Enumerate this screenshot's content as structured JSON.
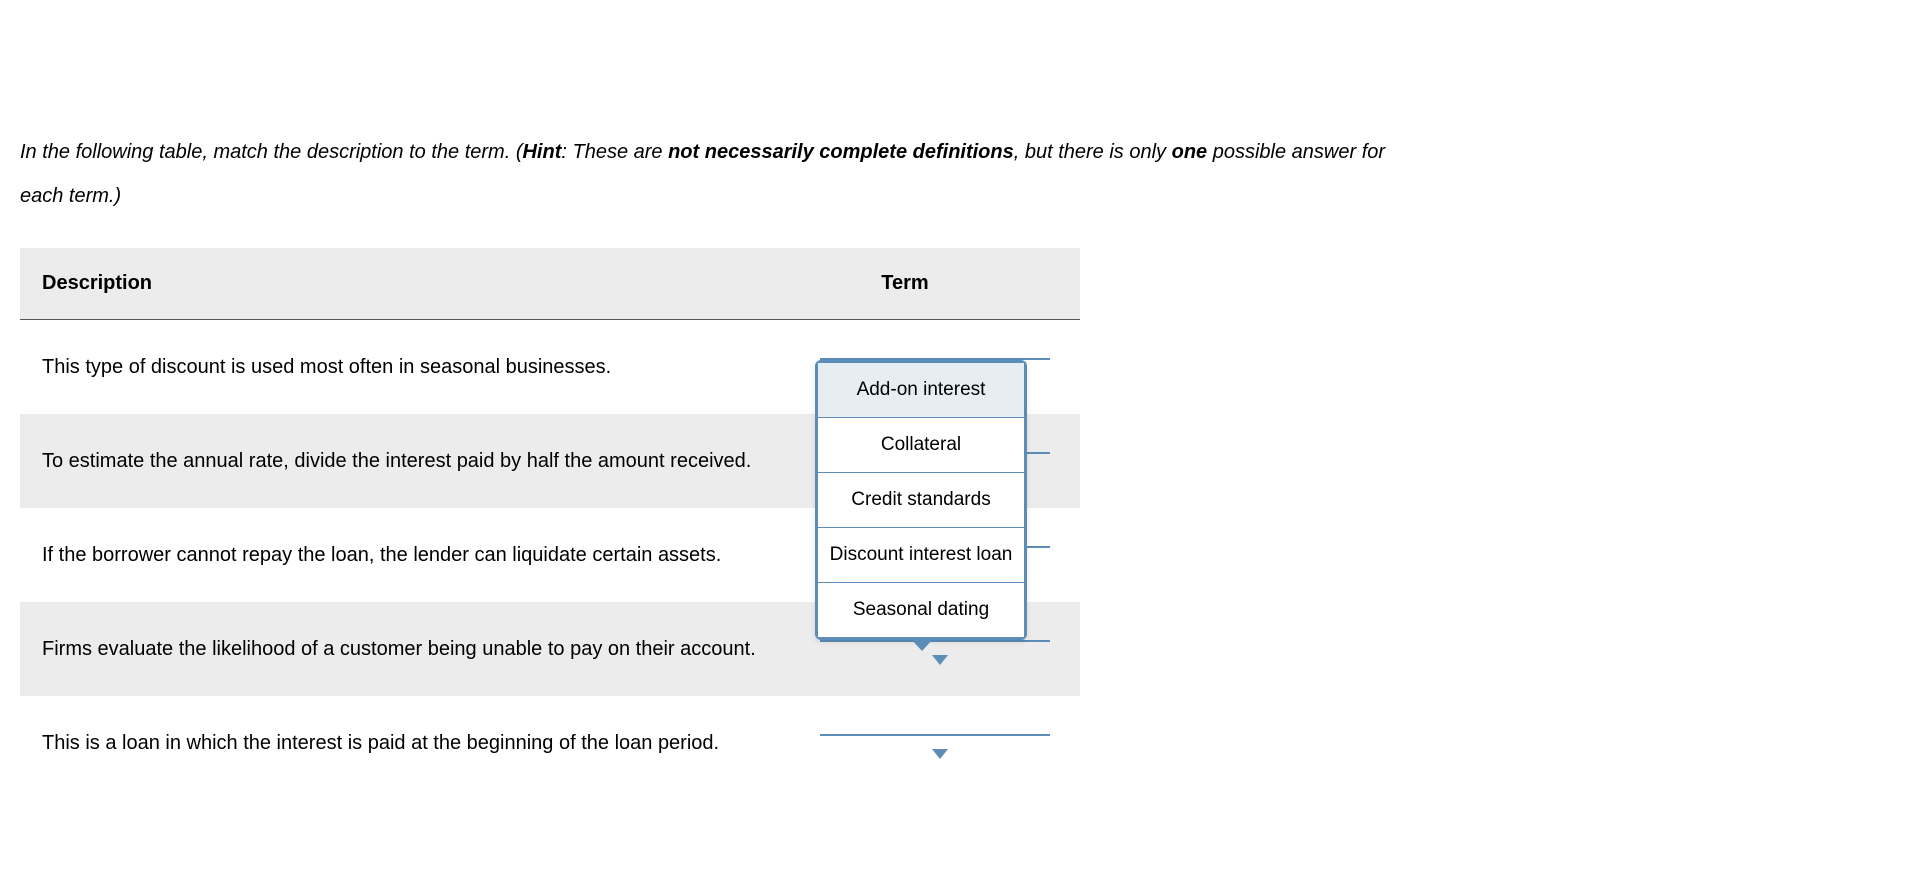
{
  "instructions": {
    "pre": "In the following table, match the description to the term. (",
    "hint_label": "Hint",
    "mid1": ": These are ",
    "bold1": "not necessarily complete definitions",
    "mid2": ", but there is only ",
    "bold2": "one",
    "post": " possible answer for each term.)"
  },
  "table": {
    "headers": {
      "description": "Description",
      "term": "Term"
    },
    "rows": [
      {
        "description": "This type of discount is used most often in seasonal businesses."
      },
      {
        "description": "To estimate the annual rate, divide the interest paid by half the amount received."
      },
      {
        "description": "If the borrower cannot repay the loan, the lender can liquidate certain assets."
      },
      {
        "description": "Firms evaluate the likelihood of a customer being unable to pay on their account."
      },
      {
        "description": "This is a loan in which the interest is paid at the beginning of the loan period."
      }
    ]
  },
  "dropdown": {
    "options": [
      "Add-on interest",
      "Collateral",
      "Credit standards",
      "Discount interest loan",
      "Seasonal dating"
    ],
    "highlighted_index": 0
  },
  "colors": {
    "accent": "#5b8db8"
  }
}
